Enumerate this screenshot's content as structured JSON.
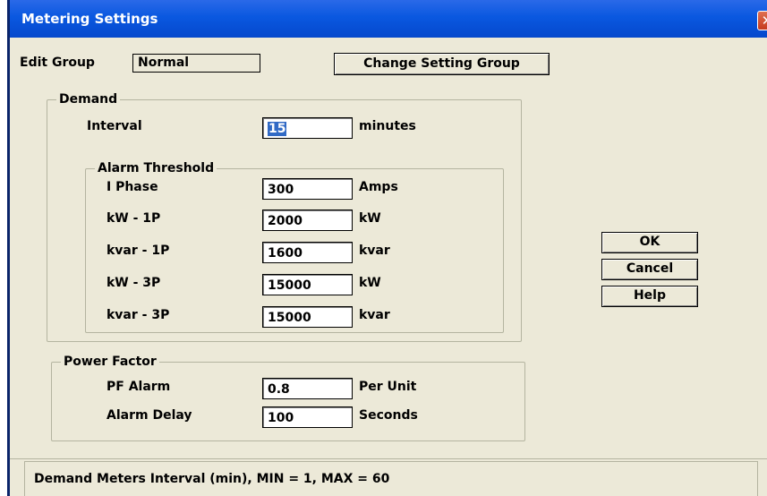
{
  "window": {
    "title": "Metering Settings",
    "close_glyph": "✕"
  },
  "edit_group": {
    "label": "Edit Group",
    "value": "Normal"
  },
  "buttons": {
    "change_group": "Change Setting Group",
    "ok": "OK",
    "cancel": "Cancel",
    "help": "Help"
  },
  "demand": {
    "legend": "Demand",
    "interval": {
      "label": "Interval",
      "value": "15",
      "unit": "minutes"
    },
    "alarm_threshold": {
      "legend": "Alarm Threshold",
      "rows": [
        {
          "label": "I Phase",
          "value": "300",
          "unit": "Amps"
        },
        {
          "label": "kW - 1P",
          "value": "2000",
          "unit": "kW"
        },
        {
          "label": "kvar - 1P",
          "value": "1600",
          "unit": "kvar"
        },
        {
          "label": "kW - 3P",
          "value": "15000",
          "unit": "kW"
        },
        {
          "label": "kvar - 3P",
          "value": "15000",
          "unit": "kvar"
        }
      ]
    }
  },
  "power_factor": {
    "legend": "Power Factor",
    "pf_alarm": {
      "label": "PF Alarm",
      "value": "0.8",
      "unit": "Per Unit"
    },
    "alarm_delay": {
      "label": "Alarm Delay",
      "value": "100",
      "unit": "Seconds"
    }
  },
  "status": {
    "text": "Demand Meters Interval (min), MIN = 1, MAX = 60"
  },
  "colors": {
    "titlebar": "#0a58e0",
    "face": "#ece9d8",
    "selection": "#316ac5",
    "close": "#c63a1e"
  }
}
